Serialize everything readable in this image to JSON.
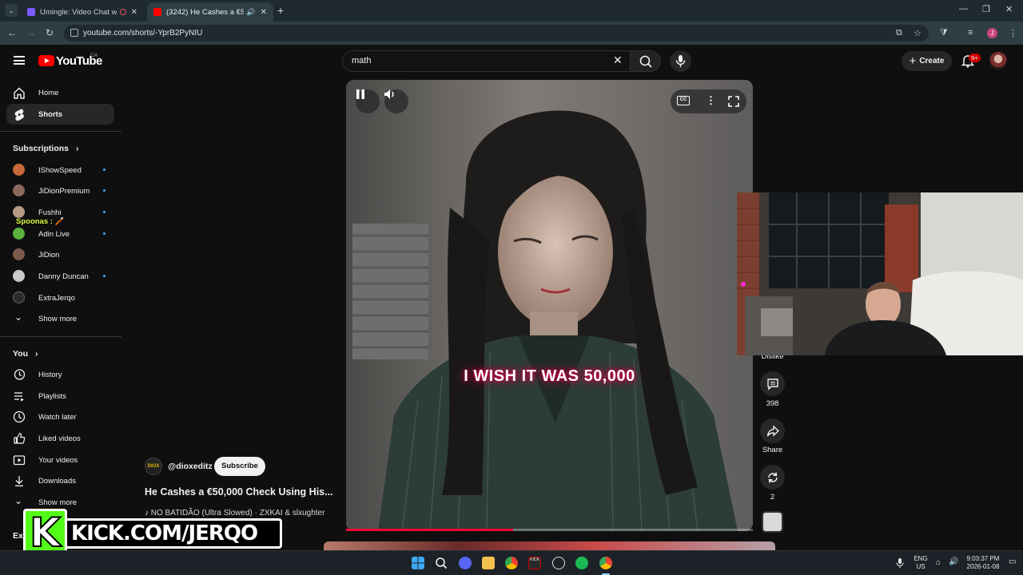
{
  "browser": {
    "tabs": [
      {
        "title": "Umingle: Video Chat with S",
        "favicon_color": "#7b5cff"
      },
      {
        "title": "(3242) He Cashes a €50,000",
        "favicon_color": "#ff0000"
      }
    ],
    "url": "youtube.com/shorts/-YprB2PyNIU",
    "profile_initial": "J"
  },
  "header": {
    "logo_text": "YouTube",
    "country_code": "CA",
    "search_value": "math",
    "create_label": "Create",
    "notifications_badge": "9+"
  },
  "sidebar": {
    "main": [
      {
        "label": "Home",
        "icon": "home-icon"
      },
      {
        "label": "Shorts",
        "icon": "shorts-icon",
        "active": true
      }
    ],
    "subscriptions_title": "Subscriptions",
    "subscriptions": [
      {
        "label": "IShowSpeed",
        "avatar_color": "#c76a3a",
        "live": true
      },
      {
        "label": "JiDionPremium",
        "avatar_color": "#8a6a5a",
        "live": true
      },
      {
        "label": "Fushhi",
        "avatar_color": "#b59a84",
        "live": true
      },
      {
        "label": "Adin Live",
        "avatar_color": "#5ab03c",
        "live": true
      },
      {
        "label": "JiDion",
        "avatar_color": "#7a5a4a",
        "live": false
      },
      {
        "label": "Danny Duncan",
        "avatar_color": "#c9c9c9",
        "live": true
      },
      {
        "label": "ExtraJerqo",
        "avatar_color": "#2b2b2b",
        "live": false
      }
    ],
    "show_more_label": "Show more",
    "you_title": "You",
    "you_items": [
      {
        "label": "History",
        "icon": "history-icon"
      },
      {
        "label": "Playlists",
        "icon": "playlists-icon"
      },
      {
        "label": "Watch later",
        "icon": "watch-later-icon"
      },
      {
        "label": "Liked videos",
        "icon": "thumbs-up-icon"
      },
      {
        "label": "Your videos",
        "icon": "your-videos-icon"
      },
      {
        "label": "Downloads",
        "icon": "download-icon"
      }
    ],
    "show_more_label_2": "Show more",
    "explore_partial": "Exp"
  },
  "overlay_chat": {
    "text": "Spoonas : 🪥"
  },
  "video": {
    "caption": "I WISH IT WAS 50,000",
    "progress": 0.41,
    "channel_handle": "@dioxeditz",
    "channel_avatar_text": "DIOX",
    "subscribe_label": "Subscribe",
    "title": "He Cashes a €50,000 Check Using His...",
    "music": "♪ NO BATIDÃO (Ultra Slowed) · ZXKAI & slxughter"
  },
  "actions": {
    "dislike_label": "Dislike",
    "comments_count": "398",
    "share_label": "Share",
    "remix_count": "2"
  },
  "stream_banner": {
    "letter": "K",
    "text": "KICK.COM/JERQO"
  },
  "taskbar": {
    "lang_top": "ENG",
    "lang_bottom": "US",
    "time": "9:03:37 PM",
    "date": "2026-01-08"
  }
}
